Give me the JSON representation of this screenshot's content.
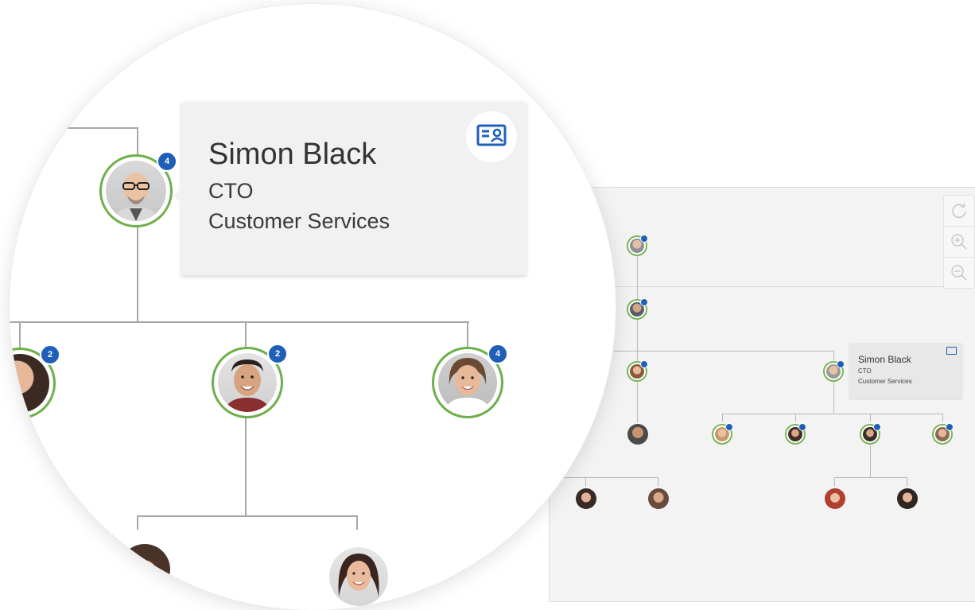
{
  "selected_person": {
    "name": "Simon Black",
    "role": "CTO",
    "department": "Customer Services",
    "reports_count": "4"
  },
  "zoomed_children": [
    {
      "reports_count": "2"
    },
    {
      "reports_count": "2"
    },
    {
      "reports_count": "4"
    }
  ],
  "controls": {
    "refresh_icon": "refresh-icon",
    "zoom_in_icon": "zoom-in-icon",
    "zoom_out_icon": "zoom-out-icon"
  },
  "colors": {
    "accent_blue": "#1f5fb8",
    "node_ring_green": "#6db04a",
    "card_bg": "#f1f1f1",
    "panel_bg": "#f3f3f3"
  }
}
